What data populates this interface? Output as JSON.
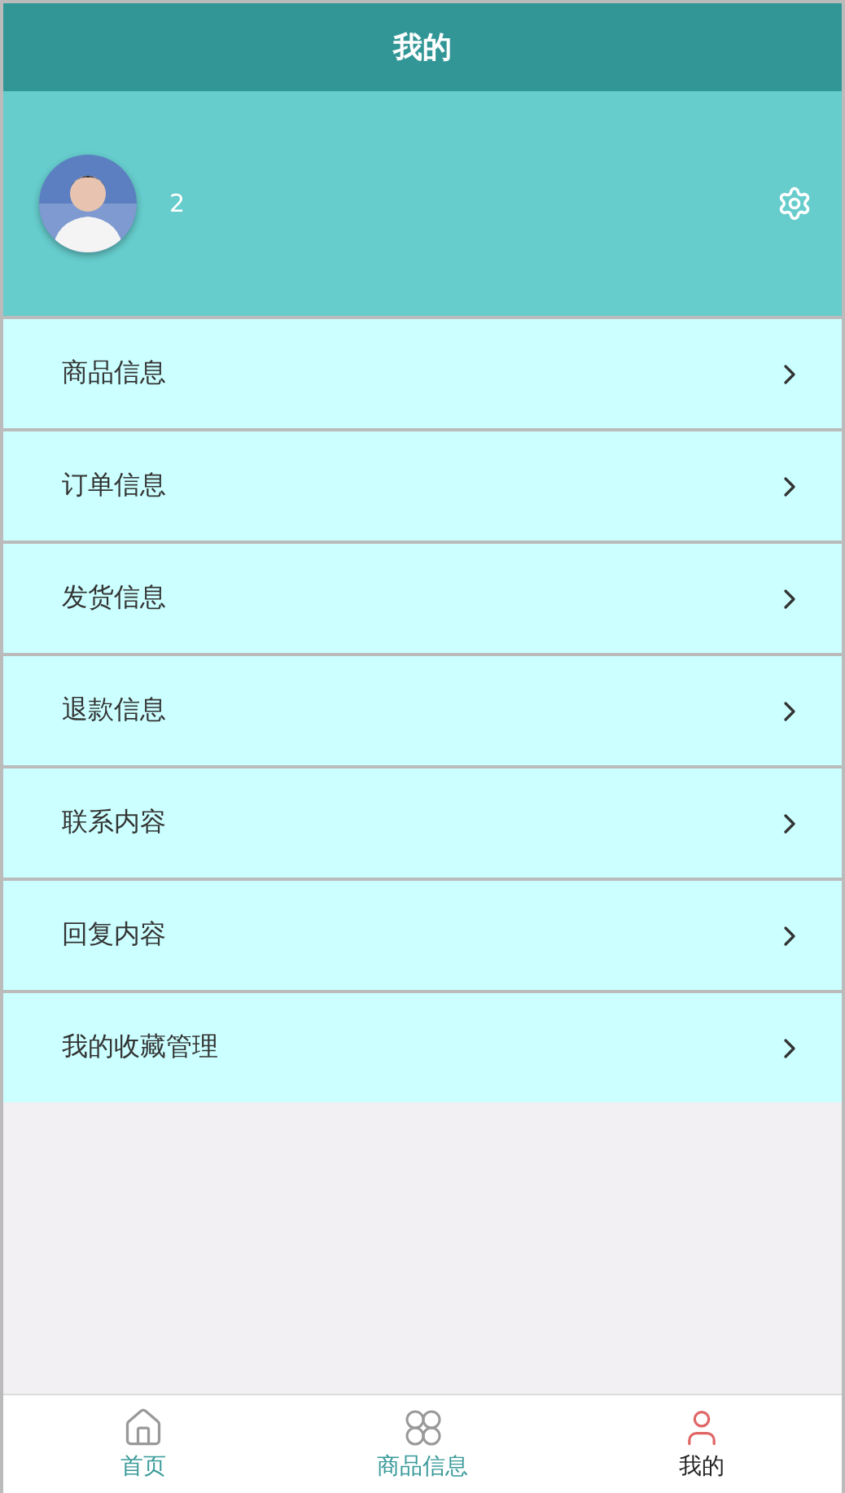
{
  "header": {
    "title": "我的"
  },
  "profile": {
    "username": "2"
  },
  "menu": [
    {
      "label": "商品信息"
    },
    {
      "label": "订单信息"
    },
    {
      "label": "发货信息"
    },
    {
      "label": "退款信息"
    },
    {
      "label": "联系内容"
    },
    {
      "label": "回复内容"
    },
    {
      "label": "我的收藏管理"
    }
  ],
  "tabbar": [
    {
      "label": "首页",
      "kind": "home",
      "selected": false
    },
    {
      "label": "商品信息",
      "kind": "grid",
      "selected": false
    },
    {
      "label": "我的",
      "kind": "user",
      "selected": true
    }
  ]
}
